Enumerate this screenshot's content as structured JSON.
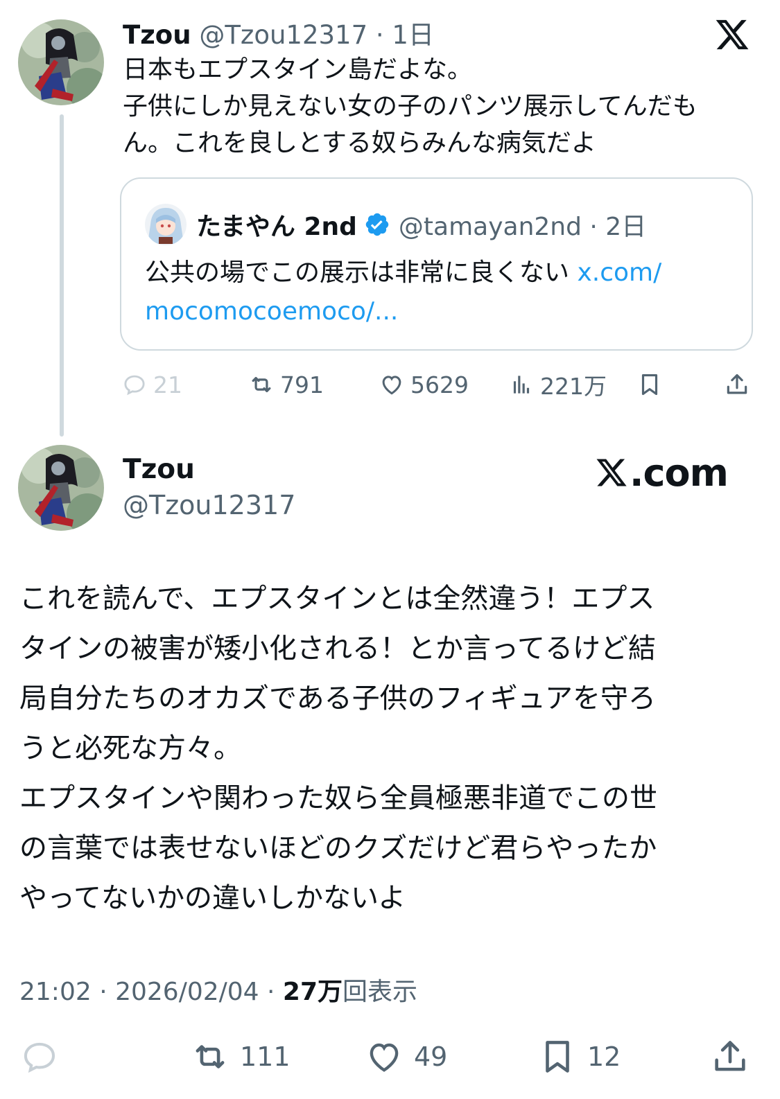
{
  "tweet": {
    "author_name": "Tzou",
    "author_handle": "@Tzou12317 · 1日",
    "lines": [
      "日本もエプスタイン島だよな。",
      "子供にしか見えない女の子のパンツ展示してんだも",
      "ん。これを良しとする奴らみんな病気だよ"
    ],
    "quote": {
      "author_name": "たまやん 2nd",
      "author_handle": "@tamayan2nd · 2日",
      "line1_text": "公共の場でこの展示は非常に良くない ",
      "line1_link": "x.com/",
      "line2_link": "mocomocoemoco/..."
    },
    "actions": {
      "replies": "21",
      "reposts": "791",
      "likes": "5629",
      "views": "221万"
    }
  },
  "main_tweet": {
    "author_name": "Tzou",
    "author_handle": "@Tzou12317",
    "brand": ".com",
    "lines": [
      "これを読んで、エプスタインとは全然違う！エプス",
      "タインの被害が矮小化される！とか言ってるけど結",
      "局自分たちのオカズである子供のフィギュアを守ろ",
      "うと必死な方々。",
      "エプスタインや関わった奴ら全員極悪非道でこの世",
      "の言葉では表せないほどのクズだけど君らやったか",
      "やってないかの違いしかないよ"
    ],
    "meta": {
      "time_date": "21:02 · 2026/02/04 · ",
      "views_count": "27万",
      "views_label": "回表示"
    },
    "actions": {
      "reposts": "111",
      "likes": "49",
      "bookmarks": "12"
    }
  },
  "icons": [
    "x-logo-icon",
    "verified-badge-icon",
    "reply-icon",
    "repost-icon",
    "like-icon",
    "views-icon",
    "bookmark-icon",
    "share-icon"
  ],
  "colors": {
    "text": "#0f1419",
    "secondary": "#536471",
    "link": "#1d9bf0",
    "border": "#cfd9de"
  }
}
